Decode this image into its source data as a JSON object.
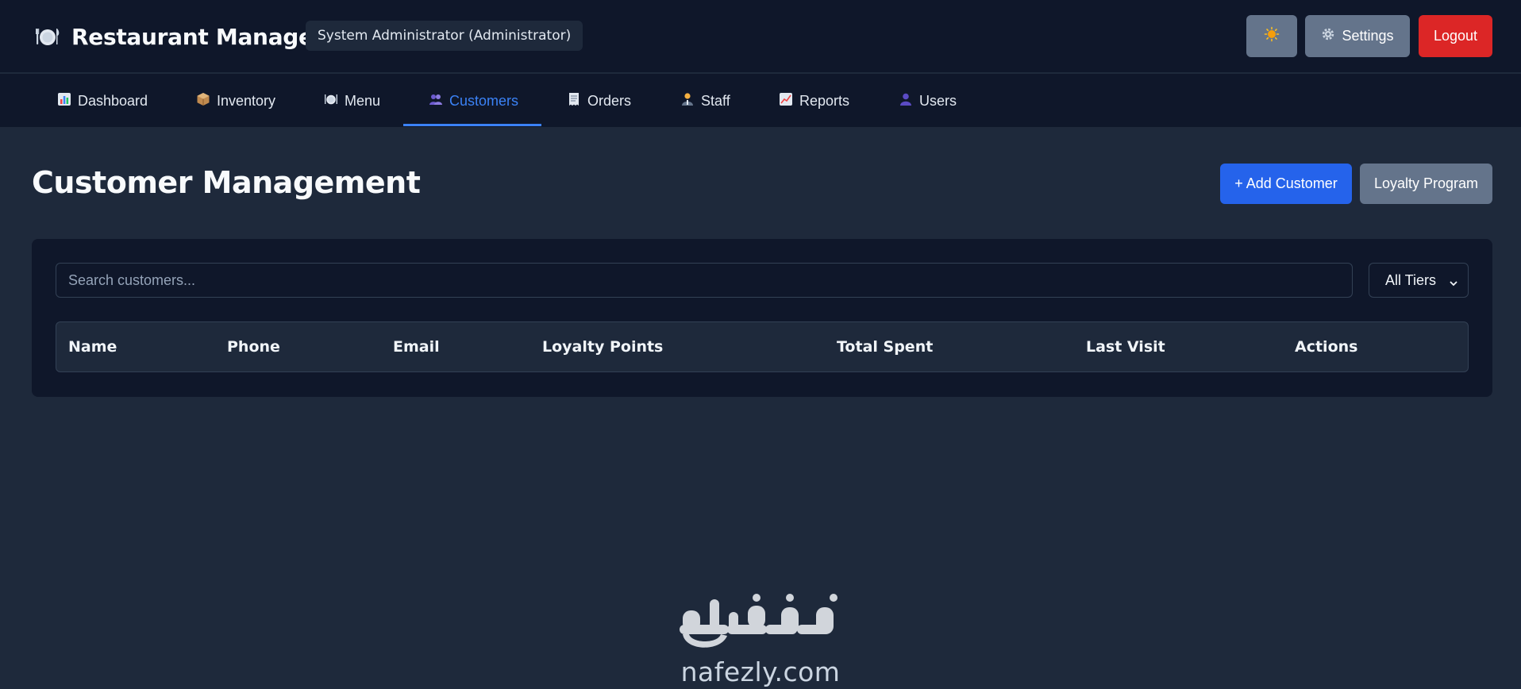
{
  "header": {
    "app_title": "Restaurant Manager",
    "app_icon": "plate-cutlery-icon",
    "user_badge": "System Administrator (Administrator)",
    "theme_icon": "sun-icon",
    "settings_label": "Settings",
    "settings_icon": "gear-icon",
    "logout_label": "Logout"
  },
  "nav": {
    "tabs": [
      {
        "label": "Dashboard",
        "icon": "bar-chart-icon"
      },
      {
        "label": "Inventory",
        "icon": "package-icon"
      },
      {
        "label": "Menu",
        "icon": "plate-cutlery-icon"
      },
      {
        "label": "Customers",
        "icon": "people-icon",
        "active": true
      },
      {
        "label": "Orders",
        "icon": "receipt-icon"
      },
      {
        "label": "Staff",
        "icon": "person-icon"
      },
      {
        "label": "Reports",
        "icon": "line-chart-icon"
      },
      {
        "label": "Users",
        "icon": "user-icon"
      }
    ]
  },
  "page": {
    "title": "Customer Management",
    "add_button": "+ Add Customer",
    "loyalty_button": "Loyalty Program"
  },
  "filters": {
    "search_placeholder": "Search customers...",
    "tier_selected": "All Tiers"
  },
  "table": {
    "columns": [
      "Name",
      "Phone",
      "Email",
      "Loyalty Points",
      "Total Spent",
      "Last Visit",
      "Actions"
    ],
    "rows": []
  },
  "watermark": {
    "arabic": "نفذلي",
    "domain": "nafezly.com"
  },
  "colors": {
    "header_bg": "#0f172a",
    "page_bg": "#1e293b",
    "accent": "#3b82f6",
    "primary_button": "#2563eb",
    "secondary_button": "#64748b",
    "danger_button": "#dc2626"
  }
}
